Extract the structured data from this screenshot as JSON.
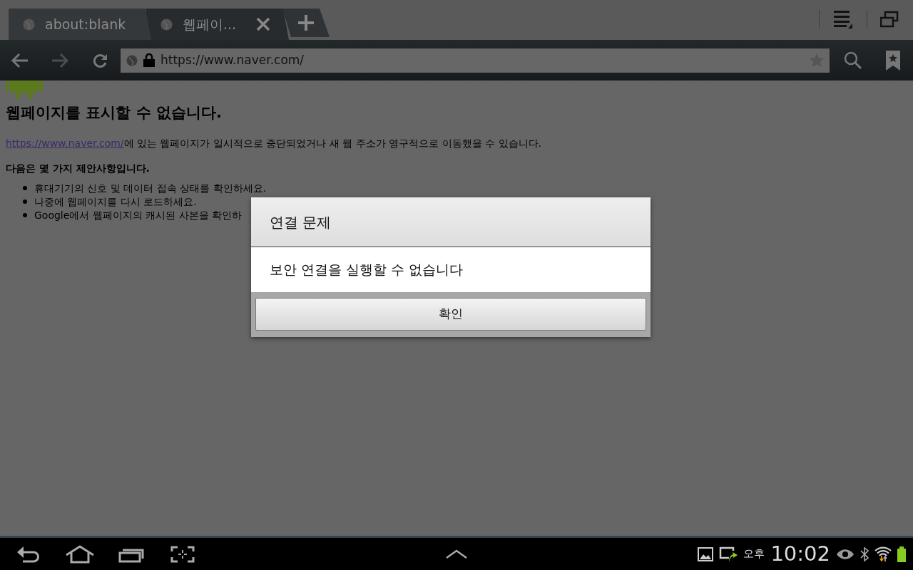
{
  "tabs": [
    {
      "title": "about:blank",
      "selected": false
    },
    {
      "title": "웹페이...",
      "selected": true
    }
  ],
  "toolbar": {
    "url": "https://www.naver.com/"
  },
  "page": {
    "heading": "웹페이지를 표시할 수 없습니다.",
    "link": "https://www.naver.com/",
    "paragraph": "에 있는 웹페이지가 일시적으로 중단되었거나 새 웹 주소가 영구적으로 이동했을 수 있습니다.",
    "suggestions_title": "다음은 몇 가지 제안사항입니다.",
    "suggestions": [
      "휴대기기의 신호 및 데이터 접속 상태를 확인하세요.",
      "나중에 웹페이지를 다시 로드하세요.",
      "Google에서 웹페이지의 캐시된 사본을 확인하"
    ]
  },
  "dialog": {
    "title": "연결 문제",
    "message": "보안 연결을 실행할 수 없습니다",
    "button": "확인"
  },
  "status_bar": {
    "am_pm": "오후",
    "time": "10:02"
  }
}
